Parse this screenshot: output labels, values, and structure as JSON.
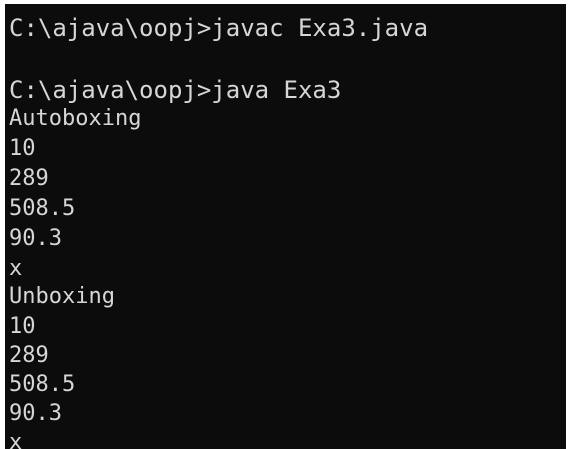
{
  "console": {
    "lines": [
      "C:\\ajava\\oopj>javac Exa3.java",
      "C:\\ajava\\oopj>java Exa3",
      "Autoboxing",
      "10",
      "289",
      "508.5",
      "90.3",
      "x",
      "Unboxing",
      "10",
      "289",
      "508.5",
      "90.3",
      "x"
    ]
  },
  "colors": {
    "background": "#0c0c0c",
    "text": "#d6d6d6"
  }
}
